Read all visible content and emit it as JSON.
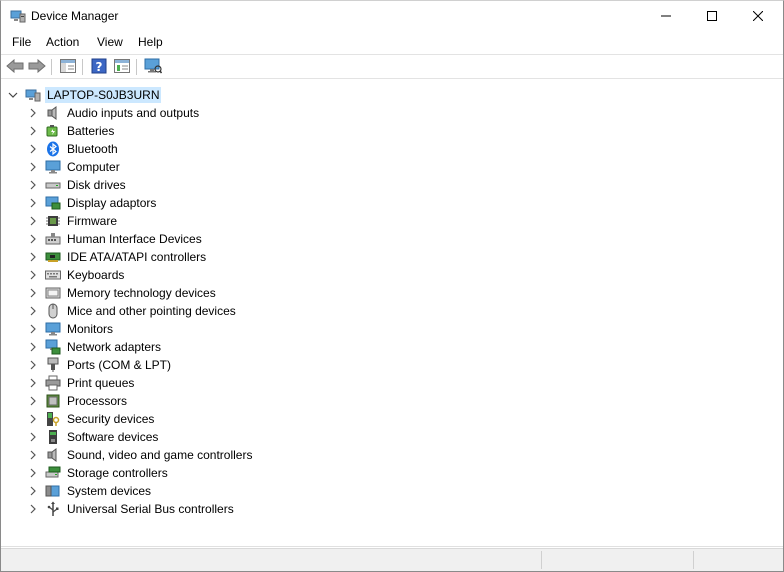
{
  "window": {
    "title": "Device Manager",
    "controls": {
      "minimize": "minimize",
      "maximize": "maximize",
      "close": "close"
    }
  },
  "menu": [
    "File",
    "Action",
    "View",
    "Help"
  ],
  "toolbar": {
    "buttons": [
      "back-icon",
      "forward-icon",
      "show-hide-console-tree-icon",
      "help-icon",
      "properties-icon",
      "scan-hardware-icon"
    ]
  },
  "tree": {
    "root": {
      "label": "LAPTOP-S0JB3URN",
      "icon": "computer-icon",
      "expanded": true,
      "selected": true
    },
    "categories": [
      {
        "label": "Audio inputs and outputs",
        "icon": "speaker-icon"
      },
      {
        "label": "Batteries",
        "icon": "battery-icon"
      },
      {
        "label": "Bluetooth",
        "icon": "bluetooth-icon"
      },
      {
        "label": "Computer",
        "icon": "monitor-icon"
      },
      {
        "label": "Disk drives",
        "icon": "disk-drive-icon"
      },
      {
        "label": "Display adaptors",
        "icon": "display-adapter-icon"
      },
      {
        "label": "Firmware",
        "icon": "chip-icon"
      },
      {
        "label": "Human Interface Devices",
        "icon": "hid-icon"
      },
      {
        "label": "IDE ATA/ATAPI controllers",
        "icon": "controller-card-icon"
      },
      {
        "label": "Keyboards",
        "icon": "keyboard-icon"
      },
      {
        "label": "Memory technology devices",
        "icon": "memory-icon"
      },
      {
        "label": "Mice and other pointing devices",
        "icon": "mouse-icon"
      },
      {
        "label": "Monitors",
        "icon": "monitor-icon"
      },
      {
        "label": "Network adapters",
        "icon": "network-icon"
      },
      {
        "label": "Ports (COM & LPT)",
        "icon": "port-icon"
      },
      {
        "label": "Print queues",
        "icon": "printer-icon"
      },
      {
        "label": "Processors",
        "icon": "processor-icon"
      },
      {
        "label": "Security devices",
        "icon": "security-icon"
      },
      {
        "label": "Software devices",
        "icon": "software-device-icon"
      },
      {
        "label": "Sound, video and game controllers",
        "icon": "speaker-icon"
      },
      {
        "label": "Storage controllers",
        "icon": "storage-controller-icon"
      },
      {
        "label": "System devices",
        "icon": "system-device-icon"
      },
      {
        "label": "Universal Serial Bus controllers",
        "icon": "usb-icon"
      }
    ]
  },
  "colors": {
    "selection": "#cce8ff",
    "accent": "#0078d7"
  }
}
